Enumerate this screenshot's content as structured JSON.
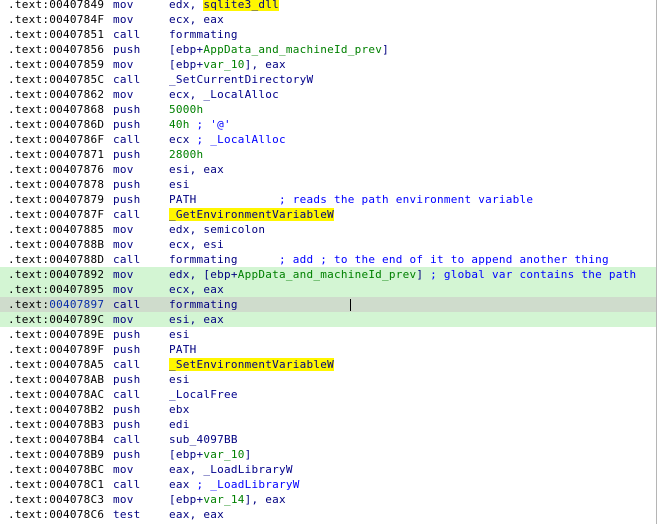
{
  "listing": {
    "rows": [
      {
        "seg": ".text",
        "addr": "00407849",
        "mn": "mov",
        "op": [
          "edx, ",
          {
            "t": "sqlite3_dll",
            "c": "y"
          }
        ]
      },
      {
        "seg": ".text",
        "addr": "0040784F",
        "mn": "mov",
        "op": [
          "ecx, eax"
        ]
      },
      {
        "seg": ".text",
        "addr": "00407851",
        "mn": "call",
        "op": [
          {
            "t": "formmating",
            "c": "name"
          }
        ]
      },
      {
        "seg": ".text",
        "addr": "00407856",
        "mn": "push",
        "op": [
          "[ebp+",
          {
            "t": "AppData_and_machineId_prev",
            "c": "gv"
          },
          "]"
        ]
      },
      {
        "seg": ".text",
        "addr": "00407859",
        "mov": true,
        "mn": "mov",
        "op": [
          "[ebp+",
          {
            "t": "var_10",
            "c": "gv"
          },
          "], eax"
        ]
      },
      {
        "seg": ".text",
        "addr": "0040785C",
        "mn": "call",
        "op": [
          {
            "t": "_SetCurrentDirectoryW",
            "c": "imp"
          }
        ]
      },
      {
        "seg": ".text",
        "addr": "00407862",
        "mn": "mov",
        "op": [
          "ecx, ",
          {
            "t": "_LocalAlloc",
            "c": "imp"
          }
        ]
      },
      {
        "seg": ".text",
        "addr": "00407868",
        "mn": "push",
        "op": [
          {
            "t": "5000h",
            "c": "n"
          }
        ]
      },
      {
        "seg": ".text",
        "addr": "0040786D",
        "mn": "push",
        "op": [
          {
            "t": "40h",
            "c": "n"
          },
          {
            "t": " ; '@'",
            "c": "cm"
          }
        ]
      },
      {
        "seg": ".text",
        "addr": "0040786F",
        "mn": "call",
        "op": [
          "ecx",
          {
            "t": " ; _LocalAlloc",
            "c": "cm"
          }
        ]
      },
      {
        "seg": ".text",
        "addr": "00407871",
        "mn": "push",
        "op": [
          {
            "t": "2800h",
            "c": "n"
          }
        ]
      },
      {
        "seg": ".text",
        "addr": "00407876",
        "mn": "mov",
        "op": [
          "esi, eax"
        ]
      },
      {
        "seg": ".text",
        "addr": "00407878",
        "mn": "push",
        "op": [
          "esi"
        ]
      },
      {
        "seg": ".text",
        "addr": "00407879",
        "mn": "push",
        "op": [
          {
            "t": "PATH",
            "c": "name"
          },
          {
            "t": "            ; reads the path environment variable",
            "c": "cm"
          }
        ]
      },
      {
        "seg": ".text",
        "addr": "0040787F",
        "mn": "call",
        "op": [
          {
            "t": "_GetEnvironmentVariableW",
            "c": "y"
          }
        ]
      },
      {
        "seg": ".text",
        "addr": "00407885",
        "mn": "mov",
        "op": [
          "edx, ",
          {
            "t": "semicolon",
            "c": "name"
          }
        ]
      },
      {
        "seg": ".text",
        "addr": "0040788B",
        "mn": "mov",
        "op": [
          "ecx, esi"
        ]
      },
      {
        "seg": ".text",
        "addr": "0040788D",
        "mn": "call",
        "op": [
          {
            "t": "formmating",
            "c": "name"
          },
          {
            "t": "      ; add ; to the end of it to append another thing",
            "c": "cm"
          }
        ]
      },
      {
        "seg": ".text",
        "addr": "00407892",
        "mn": "mov",
        "hl": true,
        "op": [
          "edx, [ebp+",
          {
            "t": "AppData_and_machineId_prev",
            "c": "gv"
          },
          "]",
          {
            "t": " ; global var contains the path",
            "c": "cm"
          }
        ]
      },
      {
        "seg": ".text",
        "addr": "00407895",
        "mn": "mov",
        "hl": true,
        "op": [
          "ecx, eax"
        ]
      },
      {
        "seg": ".text",
        "addr": "00407897",
        "mn": "call",
        "cur": true,
        "op": [
          {
            "t": "formmating",
            "c": "name"
          }
        ]
      },
      {
        "seg": ".text",
        "addr": "0040789C",
        "mn": "mov",
        "hl": true,
        "op": [
          "esi, eax"
        ]
      },
      {
        "seg": ".text",
        "addr": "0040789E",
        "mn": "push",
        "op": [
          "esi"
        ]
      },
      {
        "seg": ".text",
        "addr": "0040789F",
        "mn": "push",
        "op": [
          {
            "t": "PATH",
            "c": "name"
          }
        ]
      },
      {
        "seg": ".text",
        "addr": "004078A5",
        "mn": "call",
        "op": [
          {
            "t": "_SetEnvironmentVariableW",
            "c": "y"
          }
        ]
      },
      {
        "seg": ".text",
        "addr": "004078AB",
        "mn": "push",
        "op": [
          "esi"
        ]
      },
      {
        "seg": ".text",
        "addr": "004078AC",
        "mn": "call",
        "op": [
          {
            "t": "_LocalFree",
            "c": "imp"
          }
        ]
      },
      {
        "seg": ".text",
        "addr": "004078B2",
        "mn": "push",
        "op": [
          "ebx"
        ]
      },
      {
        "seg": ".text",
        "addr": "004078B3",
        "mn": "push",
        "op": [
          "edi"
        ]
      },
      {
        "seg": ".text",
        "addr": "004078B4",
        "mn": "call",
        "op": [
          {
            "t": "sub_4097BB",
            "c": "name"
          }
        ]
      },
      {
        "seg": ".text",
        "addr": "004078B9",
        "mn": "push",
        "op": [
          "[ebp+",
          {
            "t": "var_10",
            "c": "gv"
          },
          "]"
        ]
      },
      {
        "seg": ".text",
        "addr": "004078BC",
        "mn": "mov",
        "op": [
          "eax, ",
          {
            "t": "_LoadLibraryW",
            "c": "imp"
          }
        ]
      },
      {
        "seg": ".text",
        "addr": "004078C1",
        "mn": "call",
        "op": [
          "eax",
          {
            "t": " ; _LoadLibraryW",
            "c": "cm"
          }
        ]
      },
      {
        "seg": ".text",
        "addr": "004078C3",
        "mn": "mov",
        "op": [
          "[ebp+",
          {
            "t": "var_14",
            "c": "gv"
          },
          "], eax"
        ]
      },
      {
        "seg": ".text",
        "addr": "004078C6",
        "mn": "test",
        "op": [
          "eax, eax"
        ]
      }
    ]
  },
  "colors": {
    "highlight_row": "#d3f5d3",
    "current_row": "#cfdccc",
    "name_highlight": "#fff600",
    "comment": "#0000ff",
    "number": "#008000"
  }
}
